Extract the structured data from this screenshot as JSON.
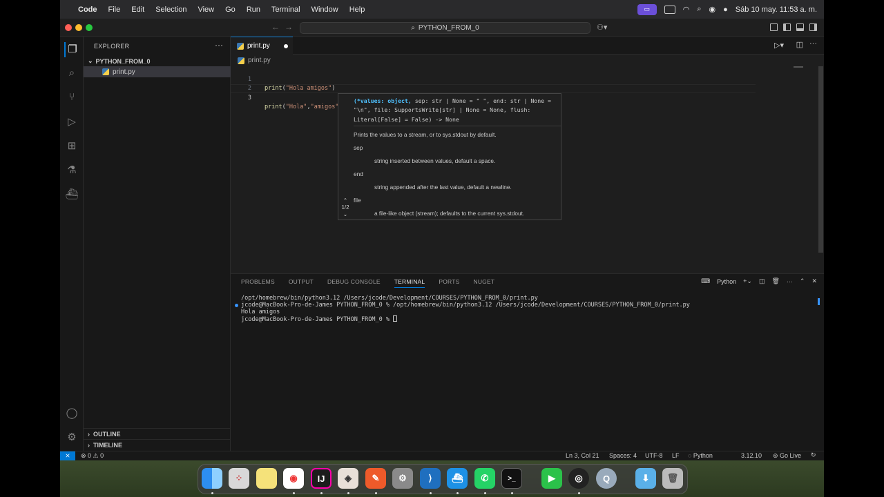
{
  "menubar": {
    "apple": "",
    "app": "Code",
    "items": [
      "File",
      "Edit",
      "Selection",
      "View",
      "Go",
      "Run",
      "Terminal",
      "Window",
      "Help"
    ],
    "datetime": "Sáb 10 may.  11:53 a. m."
  },
  "titlebar": {
    "search": "PYTHON_FROM_0"
  },
  "explorer": {
    "header": "EXPLORER",
    "more": "···",
    "folder": "PYTHON_FROM_0",
    "file": "print.py",
    "outline": "OUTLINE",
    "timeline": "TIMELINE"
  },
  "tab": {
    "label": "print.py"
  },
  "breadcrumb": "print.py",
  "code": {
    "l1": {
      "num": "1",
      "fn": "print",
      "open": "(",
      "str": "\"Hola amigos\"",
      "close": ")"
    },
    "l2": {
      "num": "2"
    },
    "l3": {
      "num": "3",
      "fn": "print",
      "open": "(",
      "s1": "\"Hola\"",
      "comma": ",",
      "s2": "\"amigos\"",
      "close": ")"
    }
  },
  "hover": {
    "sig_bold": "(*values: object,",
    "sig_rest": " sep: str | None = \" \", end: str | None = \"\\n\", file: SupportsWrite[str] | None = None, flush: Literal[False] = False) -> None",
    "desc": "Prints the values to a stream, or to sys.stdout by default.",
    "p1_name": "sep",
    "p1_desc": "string inserted between values, default a space.",
    "p2_name": "end",
    "p2_desc": "string appended after the last value, default a newline.",
    "p3_name": "file",
    "p3_desc": "a file-like object (stream); defaults to the current sys.stdout.",
    "pager": "1/2"
  },
  "panel": {
    "tabs": [
      "PROBLEMS",
      "OUTPUT",
      "DEBUG CONSOLE",
      "TERMINAL",
      "PORTS",
      "NUGET"
    ],
    "active": "TERMINAL",
    "shell": "Python",
    "lines": [
      "/opt/homebrew/bin/python3.12 /Users/jcode/Development/COURSES/PYTHON_FROM_0/print.py",
      "jcode@MacBook-Pro-de-James PYTHON_FROM_0 % /opt/homebrew/bin/python3.12 /Users/jcode/Development/COURSES/PYTHON_FROM_0/print.py",
      "Hola amigos",
      "jcode@MacBook-Pro-de-James PYTHON_FROM_0 % "
    ]
  },
  "status": {
    "remote": "⨯",
    "problems": "⊗ 0 ⚠ 0",
    "position": "Ln 3, Col 21",
    "spaces": "Spaces: 4",
    "encoding": "UTF-8",
    "eol": "LF",
    "language": "Python",
    "version": "3.12.10",
    "golive": "Go Live"
  },
  "dock": {
    "icons": [
      "finder",
      "launchpad",
      "notes",
      "chrome",
      "intellij",
      "warp",
      "sublime",
      "settings",
      "vscode",
      "docker",
      "whatsapp",
      "terminal",
      "facetime",
      "obs",
      "quicktime",
      "downloads",
      "trash"
    ],
    "intellij_label": "IJ",
    "terminal_label": ">_"
  },
  "colors": {
    "accent": "#0078d4",
    "string": "#ce9178",
    "function": "#dcdcaa",
    "param": "#4fc1ff"
  }
}
